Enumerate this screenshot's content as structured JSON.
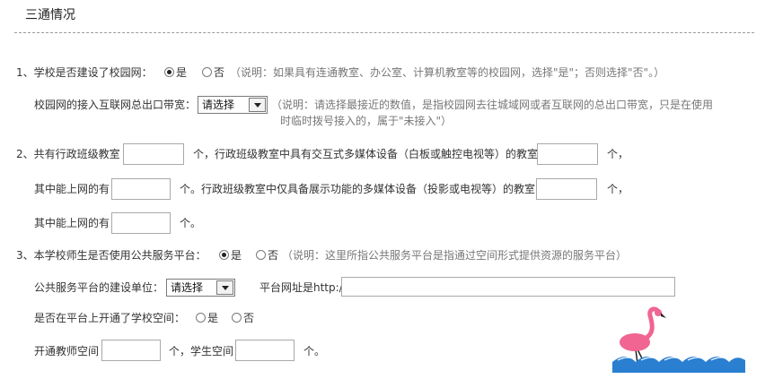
{
  "section": {
    "title": "三通情况"
  },
  "q1": {
    "label": "1、学校是否建设了校园网：",
    "yes": "是",
    "no": "否",
    "yes_checked": true,
    "no_checked": false,
    "note": "（说明：如果具有连通教室、办公室、计算机教室等的校园网，选择\"是\"；否则选择\"否\"。）",
    "bandwidth_label": "校园网的接入互联网总出口带宽：",
    "bandwidth_select": "请选择",
    "bandwidth_note_line1": "（说明：请选择最接近的数值，是指校园网去往城域网或者互联网的总出口带宽，只是在使用",
    "bandwidth_note_line2": "时临时拨号接入的，属于\"未接入\"）"
  },
  "q2": {
    "label_a": "2、共有行政班级教室",
    "unit_1": "个，行政班级教室中具有交互式多媒体设备（白板或触控电视等）的教室",
    "unit_2": "个，",
    "online_label": "其中能上网的有",
    "text_3": "个。行政班级教室中仅具备展示功能的多媒体设备（投影或电视等）的教室",
    "unit_4": "个，",
    "online_label_2": "其中能上网的有",
    "unit_5": "个。",
    "inputs": [
      "",
      "",
      "",
      "",
      ""
    ]
  },
  "q3": {
    "label": "3、本学校师生是否使用公共服务平台：",
    "yes": "是",
    "no": "否",
    "yes_checked": true,
    "no_checked": false,
    "note": "（说明：这里所指公共服务平台是指通过空间形式提供资源的服务平台）",
    "unit_label": "公共服务平台的建设单位：",
    "unit_select": "请选择",
    "url_label": "平台网址是http://",
    "url_value": "",
    "space_label": "是否在平台上开通了学校空间：",
    "space_yes": "是",
    "space_no": "否",
    "space_yes_checked": false,
    "space_no_checked": false,
    "teacher_label": "开通教师空间",
    "teacher_unit": "个，学生空间",
    "student_unit": "个。",
    "teacher_value": "",
    "student_value": ""
  },
  "colors": {
    "note": "#777777",
    "divider": "#9a9a9a",
    "logo_bird": "#f06591",
    "logo_wave": "#2a7fd1"
  },
  "icons": {
    "logo": "flamingo-logo-icon"
  }
}
